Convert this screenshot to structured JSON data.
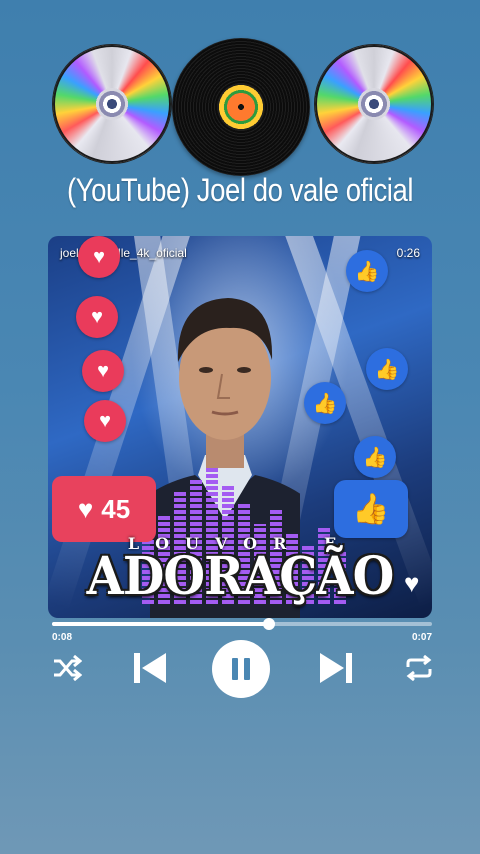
{
  "header": {
    "channel_title": "(YouTube) Joel do vale oficial"
  },
  "cover": {
    "username": "joel_do_valle_4k_oficial",
    "timer": "0:26",
    "like_count": "45",
    "subtitle_word": "LOUVOR E",
    "title_word": "ADORAÇÃO"
  },
  "player": {
    "elapsed": "0:08",
    "remaining": "0:07",
    "progress_fraction": 0.57,
    "state": "playing"
  },
  "colors": {
    "heart_red": "#ea3b5b",
    "like_blue": "#2d6ee0",
    "equalizer_purple": "#a45cf2"
  },
  "icons": [
    "cd-icon",
    "vinyl-record-icon",
    "heart-icon",
    "thumbs-up-icon",
    "shuffle-icon",
    "previous-icon",
    "pause-icon",
    "next-icon",
    "repeat-icon"
  ]
}
